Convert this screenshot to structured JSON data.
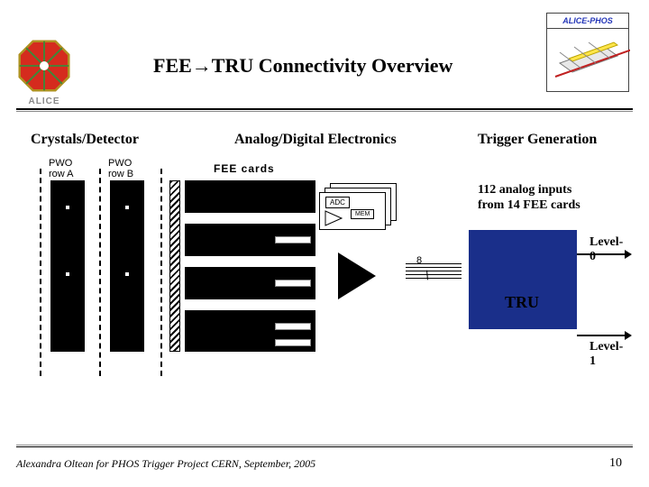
{
  "title": "FEE→TRU Connectivity Overview",
  "logo_alice": {
    "label": "ALICE"
  },
  "logo_phos": {
    "label": "ALICE-PHOS"
  },
  "sections": {
    "crystals": "Crystals/Detector",
    "analog": "Analog/Digital Electronics",
    "trigger": "Trigger Generation"
  },
  "diagram": {
    "pwo_a": "PWO\nrow A",
    "pwo_b": "PWO\nrow B",
    "fee_cards": "FEE cards",
    "adc": "ADC",
    "mem": "MEM",
    "bus_count": "8",
    "note": "112 analog inputs\nfrom 14 FEE cards",
    "tru": "TRU",
    "level0": "Level-0",
    "level1": "Level-1"
  },
  "footer": {
    "text": "Alexandra Oltean for PHOS Trigger Project CERN,    September, 2005",
    "page": "10"
  }
}
